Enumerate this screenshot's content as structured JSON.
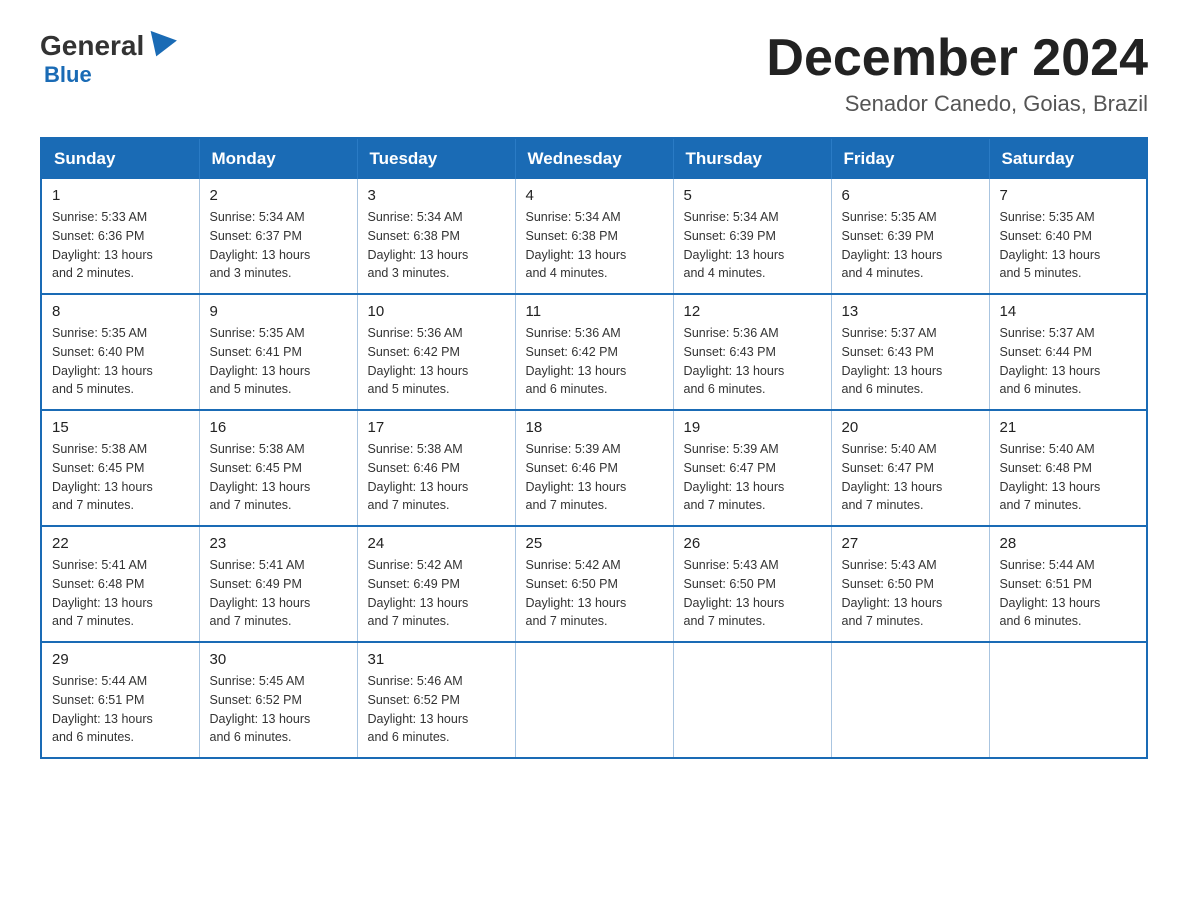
{
  "logo": {
    "general": "General",
    "blue": "Blue"
  },
  "header": {
    "month_title": "December 2024",
    "location": "Senador Canedo, Goias, Brazil"
  },
  "weekdays": [
    "Sunday",
    "Monday",
    "Tuesday",
    "Wednesday",
    "Thursday",
    "Friday",
    "Saturday"
  ],
  "weeks": [
    [
      {
        "day": "1",
        "sunrise": "5:33 AM",
        "sunset": "6:36 PM",
        "daylight": "13 hours and 2 minutes."
      },
      {
        "day": "2",
        "sunrise": "5:34 AM",
        "sunset": "6:37 PM",
        "daylight": "13 hours and 3 minutes."
      },
      {
        "day": "3",
        "sunrise": "5:34 AM",
        "sunset": "6:38 PM",
        "daylight": "13 hours and 3 minutes."
      },
      {
        "day": "4",
        "sunrise": "5:34 AM",
        "sunset": "6:38 PM",
        "daylight": "13 hours and 4 minutes."
      },
      {
        "day": "5",
        "sunrise": "5:34 AM",
        "sunset": "6:39 PM",
        "daylight": "13 hours and 4 minutes."
      },
      {
        "day": "6",
        "sunrise": "5:35 AM",
        "sunset": "6:39 PM",
        "daylight": "13 hours and 4 minutes."
      },
      {
        "day": "7",
        "sunrise": "5:35 AM",
        "sunset": "6:40 PM",
        "daylight": "13 hours and 5 minutes."
      }
    ],
    [
      {
        "day": "8",
        "sunrise": "5:35 AM",
        "sunset": "6:40 PM",
        "daylight": "13 hours and 5 minutes."
      },
      {
        "day": "9",
        "sunrise": "5:35 AM",
        "sunset": "6:41 PM",
        "daylight": "13 hours and 5 minutes."
      },
      {
        "day": "10",
        "sunrise": "5:36 AM",
        "sunset": "6:42 PM",
        "daylight": "13 hours and 5 minutes."
      },
      {
        "day": "11",
        "sunrise": "5:36 AM",
        "sunset": "6:42 PM",
        "daylight": "13 hours and 6 minutes."
      },
      {
        "day": "12",
        "sunrise": "5:36 AM",
        "sunset": "6:43 PM",
        "daylight": "13 hours and 6 minutes."
      },
      {
        "day": "13",
        "sunrise": "5:37 AM",
        "sunset": "6:43 PM",
        "daylight": "13 hours and 6 minutes."
      },
      {
        "day": "14",
        "sunrise": "5:37 AM",
        "sunset": "6:44 PM",
        "daylight": "13 hours and 6 minutes."
      }
    ],
    [
      {
        "day": "15",
        "sunrise": "5:38 AM",
        "sunset": "6:45 PM",
        "daylight": "13 hours and 7 minutes."
      },
      {
        "day": "16",
        "sunrise": "5:38 AM",
        "sunset": "6:45 PM",
        "daylight": "13 hours and 7 minutes."
      },
      {
        "day": "17",
        "sunrise": "5:38 AM",
        "sunset": "6:46 PM",
        "daylight": "13 hours and 7 minutes."
      },
      {
        "day": "18",
        "sunrise": "5:39 AM",
        "sunset": "6:46 PM",
        "daylight": "13 hours and 7 minutes."
      },
      {
        "day": "19",
        "sunrise": "5:39 AM",
        "sunset": "6:47 PM",
        "daylight": "13 hours and 7 minutes."
      },
      {
        "day": "20",
        "sunrise": "5:40 AM",
        "sunset": "6:47 PM",
        "daylight": "13 hours and 7 minutes."
      },
      {
        "day": "21",
        "sunrise": "5:40 AM",
        "sunset": "6:48 PM",
        "daylight": "13 hours and 7 minutes."
      }
    ],
    [
      {
        "day": "22",
        "sunrise": "5:41 AM",
        "sunset": "6:48 PM",
        "daylight": "13 hours and 7 minutes."
      },
      {
        "day": "23",
        "sunrise": "5:41 AM",
        "sunset": "6:49 PM",
        "daylight": "13 hours and 7 minutes."
      },
      {
        "day": "24",
        "sunrise": "5:42 AM",
        "sunset": "6:49 PM",
        "daylight": "13 hours and 7 minutes."
      },
      {
        "day": "25",
        "sunrise": "5:42 AM",
        "sunset": "6:50 PM",
        "daylight": "13 hours and 7 minutes."
      },
      {
        "day": "26",
        "sunrise": "5:43 AM",
        "sunset": "6:50 PM",
        "daylight": "13 hours and 7 minutes."
      },
      {
        "day": "27",
        "sunrise": "5:43 AM",
        "sunset": "6:50 PM",
        "daylight": "13 hours and 7 minutes."
      },
      {
        "day": "28",
        "sunrise": "5:44 AM",
        "sunset": "6:51 PM",
        "daylight": "13 hours and 6 minutes."
      }
    ],
    [
      {
        "day": "29",
        "sunrise": "5:44 AM",
        "sunset": "6:51 PM",
        "daylight": "13 hours and 6 minutes."
      },
      {
        "day": "30",
        "sunrise": "5:45 AM",
        "sunset": "6:52 PM",
        "daylight": "13 hours and 6 minutes."
      },
      {
        "day": "31",
        "sunrise": "5:46 AM",
        "sunset": "6:52 PM",
        "daylight": "13 hours and 6 minutes."
      },
      null,
      null,
      null,
      null
    ]
  ],
  "labels": {
    "sunrise": "Sunrise:",
    "sunset": "Sunset:",
    "daylight": "Daylight:"
  }
}
